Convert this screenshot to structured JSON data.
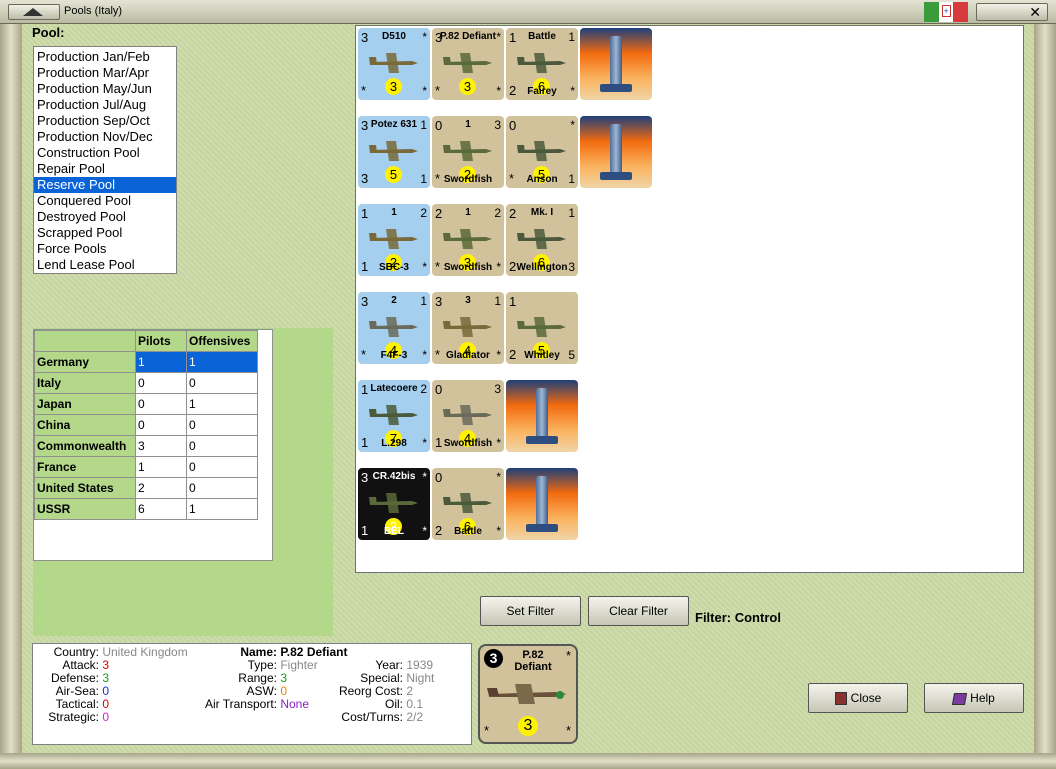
{
  "window": {
    "title": "Pools (Italy)",
    "close_glyph": "✕"
  },
  "pool": {
    "label": "Pool:",
    "items": [
      "Production Jan/Feb",
      "Production Mar/Apr",
      "Production May/Jun",
      "Production Jul/Aug",
      "Production Sep/Oct",
      "Production Nov/Dec",
      "Construction Pool",
      "Repair Pool",
      "Reserve Pool",
      "Conquered Pool",
      "Destroyed Pool",
      "Scrapped Pool",
      "Force Pools",
      "Lend Lease Pool"
    ],
    "selected": "Reserve Pool"
  },
  "nations": {
    "headers": [
      "",
      "Pilots",
      "Offensives"
    ],
    "rows": [
      {
        "name": "Germany",
        "pilots": "1",
        "offensives": "1"
      },
      {
        "name": "Italy",
        "pilots": "0",
        "offensives": "0"
      },
      {
        "name": "Japan",
        "pilots": "0",
        "offensives": "1"
      },
      {
        "name": "China",
        "pilots": "0",
        "offensives": "0"
      },
      {
        "name": "Commonwealth",
        "pilots": "3",
        "offensives": "0"
      },
      {
        "name": "France",
        "pilots": "1",
        "offensives": "0"
      },
      {
        "name": "United States",
        "pilots": "2",
        "offensives": "0"
      },
      {
        "name": "USSR",
        "pilots": "6",
        "offensives": "1"
      }
    ]
  },
  "units": {
    "colors": {
      "blue": "#a4cfee",
      "tan": "#d1c29b",
      "black": "#111111"
    },
    "counters": [
      {
        "col": 0,
        "row": 0,
        "kind": "air",
        "bg": "blue",
        "tl": "3",
        "tn": "D510",
        "tr": "*",
        "bl": "*",
        "br": "*",
        "circle": "3",
        "nm": ""
      },
      {
        "col": 1,
        "row": 0,
        "kind": "air",
        "bg": "tan",
        "tl": "3",
        "tn": "P.82 Defiant",
        "tr": "*",
        "bl": "*",
        "br": "*",
        "circle": "3",
        "nm": ""
      },
      {
        "col": 2,
        "row": 0,
        "kind": "air",
        "bg": "tan",
        "tl": "1",
        "tn": "Battle",
        "tr": "1",
        "bl": "2",
        "br": "*",
        "circle": "6",
        "nm": "Fairey"
      },
      {
        "col": 3,
        "row": 0,
        "kind": "naval"
      },
      {
        "col": 0,
        "row": 1,
        "kind": "air",
        "bg": "blue",
        "tl": "3",
        "tn": "Potez 631",
        "tr": "1",
        "bl": "3",
        "br": "1",
        "circle": "5",
        "nm": ""
      },
      {
        "col": 1,
        "row": 1,
        "kind": "air",
        "bg": "tan",
        "tl": "0",
        "tn": "1",
        "tr": "3",
        "bl": "*",
        "br": "",
        "circle": "2",
        "nm": "Swordfish"
      },
      {
        "col": 2,
        "row": 1,
        "kind": "air",
        "bg": "tan",
        "tl": "0",
        "tn": "",
        "tr": "*",
        "bl": "*",
        "br": "1",
        "circle": "5",
        "nm": "Anson"
      },
      {
        "col": 3,
        "row": 1,
        "kind": "naval"
      },
      {
        "col": 0,
        "row": 2,
        "kind": "air",
        "bg": "blue",
        "tl": "1",
        "tn": "1",
        "tr": "2",
        "bl": "1",
        "br": "*",
        "circle": "2",
        "nm": "SBC-3"
      },
      {
        "col": 1,
        "row": 2,
        "kind": "air",
        "bg": "tan",
        "tl": "2",
        "tn": "1",
        "tr": "2",
        "bl": "*",
        "br": "*",
        "circle": "3",
        "nm": "Swordfish"
      },
      {
        "col": 2,
        "row": 2,
        "kind": "air",
        "bg": "tan",
        "tl": "2",
        "tn": "Mk. I",
        "tr": "1",
        "bl": "2",
        "br": "3",
        "circle": "6",
        "nm": "Wellington"
      },
      {
        "col": 0,
        "row": 3,
        "kind": "air",
        "bg": "blue",
        "tl": "3",
        "tn": "2",
        "tr": "1",
        "bl": "*",
        "br": "*",
        "circle": "4",
        "nm": "F4F-3"
      },
      {
        "col": 1,
        "row": 3,
        "kind": "air",
        "bg": "tan",
        "tl": "3",
        "tn": "3",
        "tr": "1",
        "bl": "*",
        "br": "*",
        "circle": "4",
        "nm": "Gladiator"
      },
      {
        "col": 2,
        "row": 3,
        "kind": "air",
        "bg": "tan",
        "tl": "1",
        "tn": "",
        "tr": "",
        "bl": "2",
        "br": "5",
        "circle": "5",
        "nm": "Whitley"
      },
      {
        "col": 0,
        "row": 4,
        "kind": "air",
        "bg": "blue",
        "tl": "1",
        "tn": "Latecoere",
        "tr": "2",
        "bl": "1",
        "br": "*",
        "circle": "7",
        "nm": "L.298"
      },
      {
        "col": 1,
        "row": 4,
        "kind": "air",
        "bg": "tan",
        "tl": "0",
        "tn": "",
        "tr": "3",
        "bl": "1",
        "br": "*",
        "circle": "4",
        "nm": "Swordfish"
      },
      {
        "col": 2,
        "row": 4,
        "kind": "naval"
      },
      {
        "col": 0,
        "row": 5,
        "kind": "air",
        "bg": "black",
        "tl": "3",
        "tn": "CR.42bis",
        "tr": "*",
        "bl": "1",
        "br": "*",
        "circle": "3",
        "nm": "BEL"
      },
      {
        "col": 1,
        "row": 5,
        "kind": "air",
        "bg": "tan",
        "tl": "0",
        "tn": "",
        "tr": "*",
        "bl": "2",
        "br": "*",
        "circle": "6",
        "nm": "Battle"
      },
      {
        "col": 2,
        "row": 5,
        "kind": "naval"
      }
    ]
  },
  "filter": {
    "set_label": "Set Filter",
    "clear_label": "Clear Filter",
    "text": "Filter:  Control"
  },
  "details": {
    "country_label": "Country:",
    "country": "United Kingdom",
    "attack_label": "Attack:",
    "attack": "3",
    "defense_label": "Defense:",
    "defense": "3",
    "airsea_label": "Air-Sea:",
    "airsea": "0",
    "tactical_label": "Tactical:",
    "tactical": "0",
    "strategic_label": "Strategic:",
    "strategic": "0",
    "name_label": "Name:",
    "name": "P.82 Defiant",
    "type_label": "Type:",
    "type": "Fighter",
    "range_label": "Range:",
    "range": "3",
    "asw_label": "ASW:",
    "asw": "0",
    "airtransport_label": "Air Transport:",
    "airtransport": "None",
    "year_label": "Year:",
    "year": "1939",
    "special_label": "Special:",
    "special": "Night",
    "reorg_label": "Reorg Cost:",
    "reorg": "2",
    "oil_label": "Oil:",
    "oil": "0.1",
    "costturns_label": "Cost/Turns:",
    "costturns": "2/2"
  },
  "selected_counter": {
    "tl": "3",
    "tn": "P.82 Defiant",
    "tr": "*",
    "bl": "*",
    "br": "*",
    "circle": "3"
  },
  "buttons": {
    "close": "Close",
    "help": "Help"
  }
}
